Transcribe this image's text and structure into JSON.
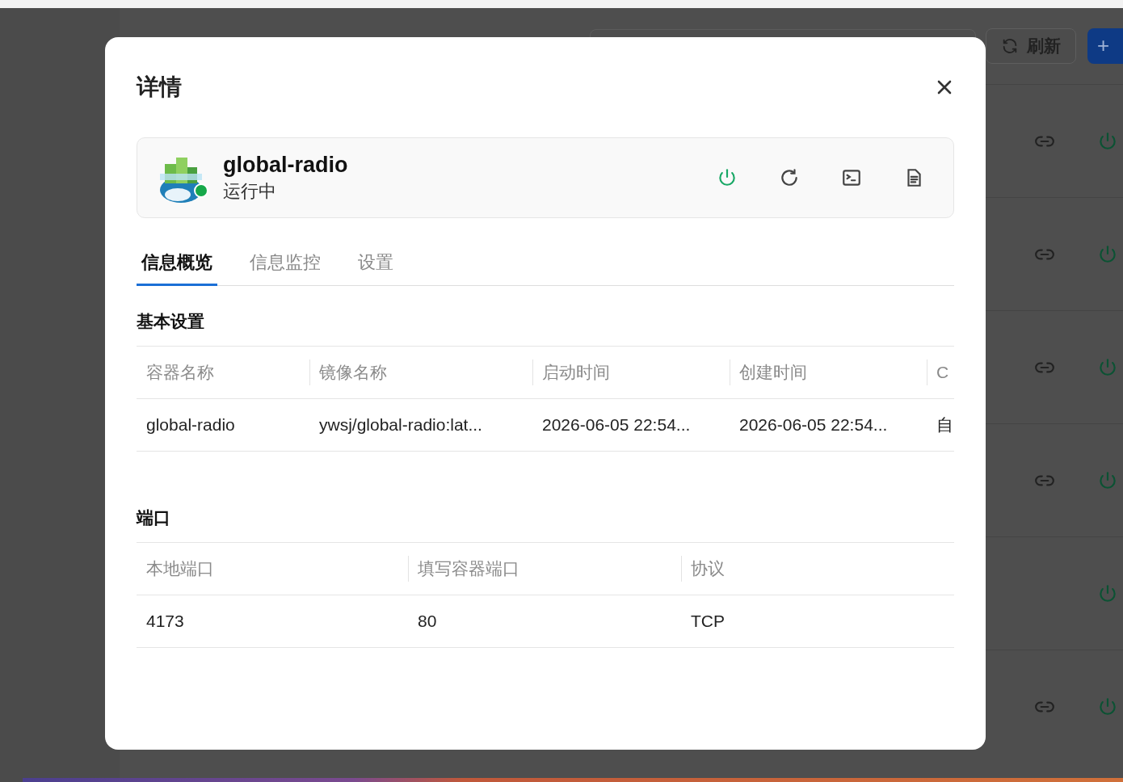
{
  "background": {
    "refresh_button": "刷新",
    "add_button": "+",
    "rows": [
      {
        "link": true
      },
      {
        "link": true
      },
      {
        "link": true
      },
      {
        "link": true
      },
      {
        "link": false
      },
      {
        "link": true
      }
    ]
  },
  "dialog": {
    "title": "详情",
    "container": {
      "name": "global-radio",
      "status": "运行中",
      "running": true
    },
    "tabs": [
      {
        "label": "信息概览",
        "selected": true
      },
      {
        "label": "信息监控",
        "selected": false
      },
      {
        "label": "设置",
        "selected": false
      }
    ],
    "sections": [
      {
        "title": "基本设置",
        "columns": [
          "容器名称",
          "镜像名称",
          "启动时间",
          "创建时间",
          "C"
        ],
        "rows": [
          [
            "global-radio",
            "ywsj/global-radio:lat...",
            "2026-06-05 22:54...",
            "2026-06-05 22:54...",
            "自"
          ]
        ]
      },
      {
        "title": "端口",
        "columns": [
          "本地端口",
          "填写容器端口",
          "协议"
        ],
        "rows": [
          [
            "4173",
            "80",
            "TCP"
          ]
        ]
      }
    ]
  }
}
